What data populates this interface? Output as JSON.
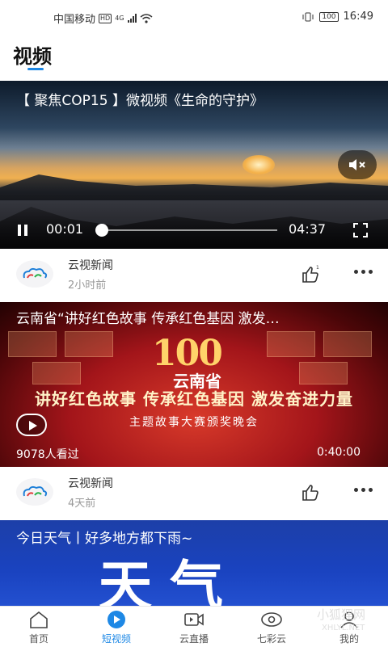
{
  "status_bar": {
    "carrier": "中国移动",
    "hd": "HD",
    "network": "4G",
    "battery": "100",
    "time": "16:49"
  },
  "header": {
    "title": "视频"
  },
  "feed": [
    {
      "title": "【 聚焦COP15 】微视频《生命的守护》",
      "current_time": "00:01",
      "duration": "04:37",
      "source": "云视新闻",
      "posted": "2小时前"
    },
    {
      "title": "云南省“讲好红色故事 传承红色基因 激发…",
      "overlay_number": "100",
      "overlay_title": "云南省",
      "overlay_slogan": "讲好红色故事 传承红色基因 激发奋进力量",
      "overlay_sub": "主题故事大赛颁奖晚会",
      "views": "9078人看过",
      "duration": "0:40:00",
      "source": "云视新闻",
      "posted": "4天前"
    },
    {
      "title": "今日天气丨好多地方都下雨~",
      "overlay_text": "天气"
    }
  ],
  "tabs": [
    {
      "label": "首页",
      "icon": "home-icon"
    },
    {
      "label": "短视频",
      "icon": "play-icon",
      "active": true
    },
    {
      "label": "云直播",
      "icon": "camera-icon"
    },
    {
      "label": "七彩云",
      "icon": "eye-icon"
    },
    {
      "label": "我的",
      "icon": "user-icon"
    }
  ],
  "watermark": {
    "text": "小狐狸网",
    "sub": "XHLYL.NET"
  },
  "colors": {
    "accent": "#1e88e5"
  }
}
